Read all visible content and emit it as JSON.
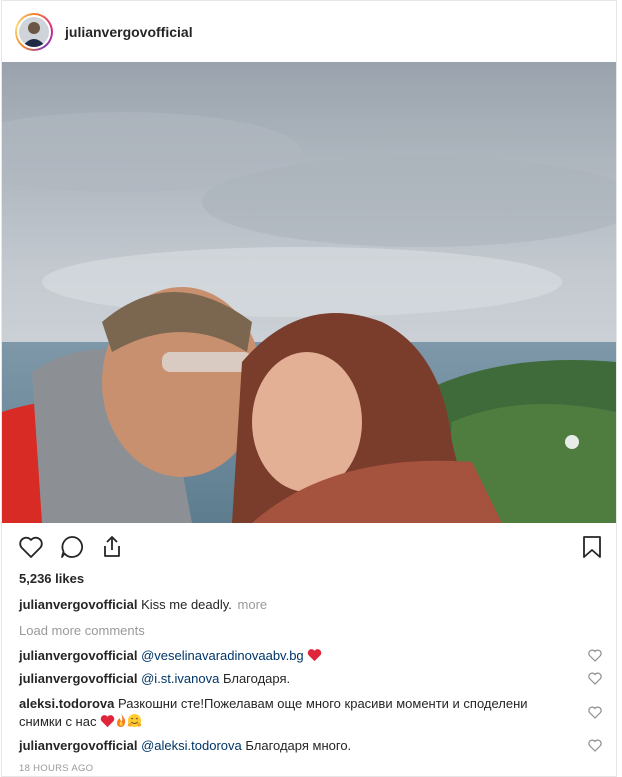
{
  "header": {
    "username": "julianvergovofficial"
  },
  "photo": {
    "alt": ""
  },
  "actions": {
    "like_icon": "heart-outline-icon",
    "comment_icon": "speech-bubble-icon",
    "share_icon": "share-icon",
    "save_icon": "bookmark-icon"
  },
  "likes": "5,236 likes",
  "caption": {
    "user": "julianvergovofficial",
    "text": "Kiss me deadly.",
    "more": "more"
  },
  "load_more": "Load more comments",
  "comments": [
    {
      "user": "julianvergovofficial",
      "mention": "@veselinavaradinovaabv.bg",
      "text": ""
    },
    {
      "user": "julianvergovofficial",
      "mention": "@i.st.ivanova",
      "text": "Благодаря."
    },
    {
      "user": "aleksi.todorova",
      "mention": "",
      "text_line1": "Разкошни сте!Пожелавам още много красиви моменти и споделени",
      "text_line2": "снимки с нас"
    },
    {
      "user": "julianvergovofficial",
      "mention": "@aleksi.todorova",
      "text": "Благодаря много."
    }
  ],
  "timestamp": "18 HOURS AGO",
  "colors": {
    "heart_red": "#e0243a",
    "mention": "#003569",
    "muted": "#999999"
  }
}
